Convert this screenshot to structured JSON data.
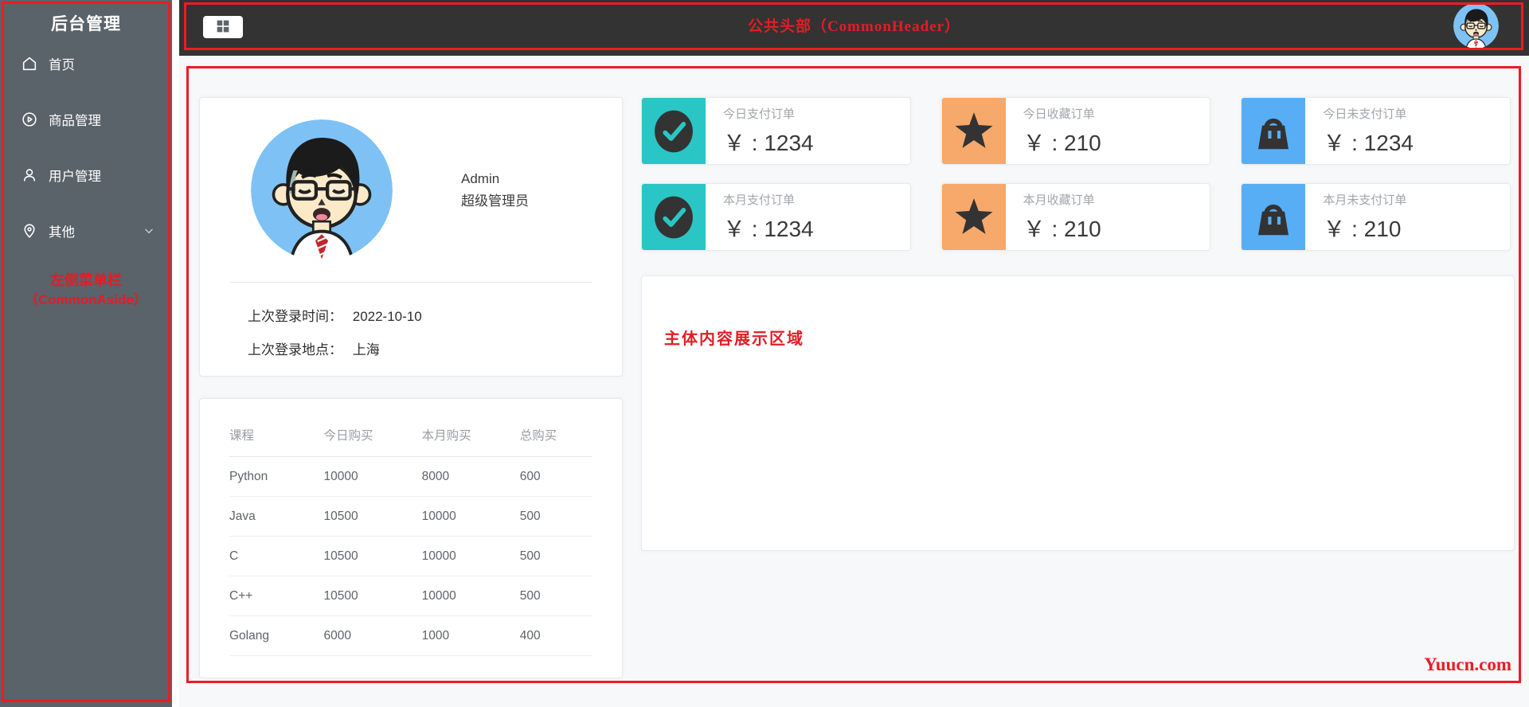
{
  "sidebar": {
    "title": "后台管理",
    "items": [
      {
        "label": "首页",
        "icon": "home-icon"
      },
      {
        "label": "商品管理",
        "icon": "video-play-icon"
      },
      {
        "label": "用户管理",
        "icon": "user-icon"
      },
      {
        "label": "其他",
        "icon": "location-icon",
        "expandable": true
      }
    ],
    "annotation_line1": "左侧菜单栏",
    "annotation_line2": "（CommonAside）"
  },
  "header": {
    "annotation": "公共头部（CommonHeader）"
  },
  "user_card": {
    "name": "Admin",
    "role": "超级管理员",
    "login_time_label": "上次登录时间：",
    "login_time": "2022-10-10",
    "login_place_label": "上次登录地点：",
    "login_place": "上海"
  },
  "course_table": {
    "columns": [
      "课程",
      "今日购买",
      "本月购买",
      "总购买"
    ],
    "rows": [
      [
        "Python",
        "10000",
        "8000",
        "600"
      ],
      [
        "Java",
        "10500",
        "10000",
        "500"
      ],
      [
        "C",
        "10500",
        "10000",
        "500"
      ],
      [
        "C++",
        "10500",
        "10000",
        "500"
      ],
      [
        "Golang",
        "6000",
        "1000",
        "400"
      ]
    ]
  },
  "stats": {
    "cards": [
      {
        "label": "今日支付订单",
        "value": "￥ : 1234",
        "icon": "check-icon",
        "color": "#2ac5c5"
      },
      {
        "label": "今日收藏订单",
        "value": "￥ : 210",
        "icon": "star-icon",
        "color": "#f6a96a"
      },
      {
        "label": "今日未支付订单",
        "value": "￥ : 1234",
        "icon": "bag-icon",
        "color": "#57aef5"
      },
      {
        "label": "本月支付订单",
        "value": "￥ : 1234",
        "icon": "check-icon",
        "color": "#2ac5c5"
      },
      {
        "label": "本月收藏订单",
        "value": "￥ : 210",
        "icon": "star-icon",
        "color": "#f6a96a"
      },
      {
        "label": "本月未支付订单",
        "value": "￥ : 210",
        "icon": "bag-icon",
        "color": "#57aef5"
      }
    ]
  },
  "main": {
    "annotation": "主体内容展示区域",
    "watermark": "Yuucn.com"
  },
  "colors": {
    "annotation_red": "#ed1c24",
    "sidebar_bg": "#5a626a",
    "header_bg": "#333333",
    "teal": "#2ac5c5",
    "orange": "#f6a96a",
    "blue": "#57aef5"
  }
}
